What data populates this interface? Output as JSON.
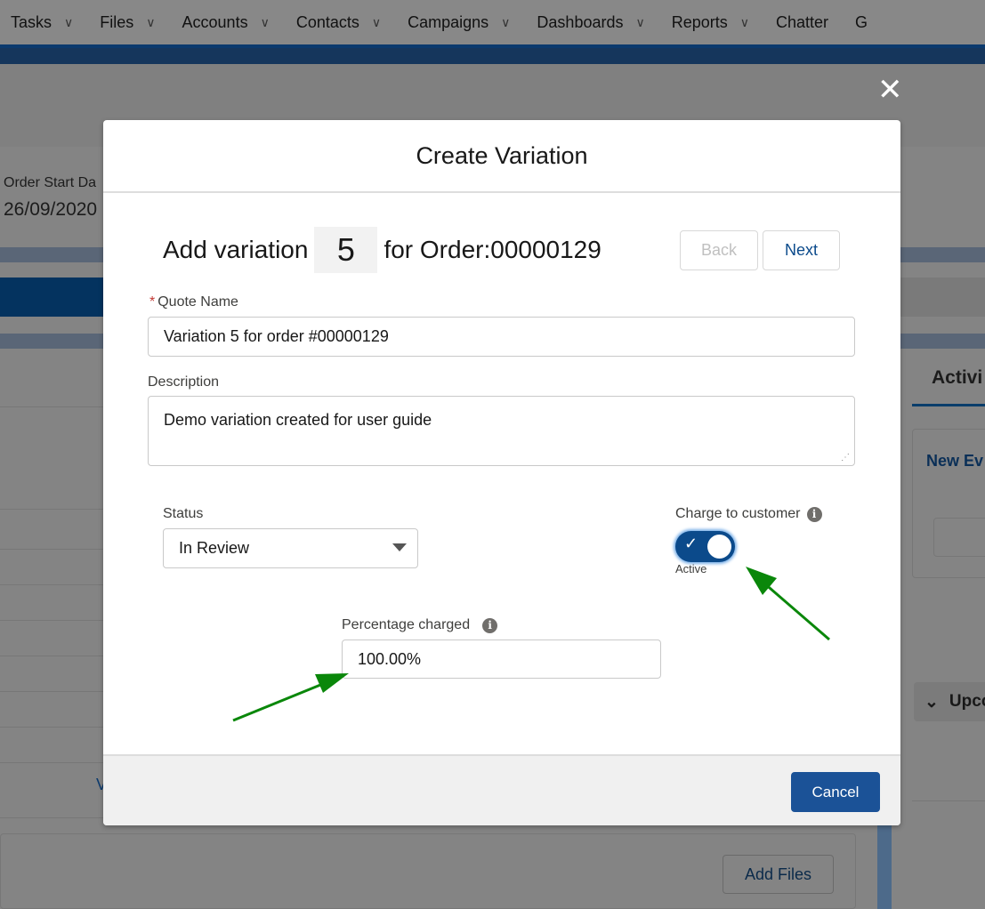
{
  "nav": {
    "items": [
      {
        "label": "Tasks",
        "dropdown": true
      },
      {
        "label": "Files",
        "dropdown": true
      },
      {
        "label": "Accounts",
        "dropdown": true
      },
      {
        "label": "Contacts",
        "dropdown": true
      },
      {
        "label": "Campaigns",
        "dropdown": true
      },
      {
        "label": "Dashboards",
        "dropdown": true
      },
      {
        "label": "Reports",
        "dropdown": true
      },
      {
        "label": "Chatter",
        "dropdown": false
      },
      {
        "label": "G",
        "dropdown": false
      }
    ]
  },
  "background": {
    "order_start_label": "Order Start Da",
    "order_start_value": "26/09/2020",
    "activity_tab": "Activi",
    "new_event": "New Ev",
    "upcoming": "Upco",
    "add_files": "Add Files",
    "partial_link": "V"
  },
  "modal": {
    "title": "Create Variation",
    "heading_prefix": "Add variation",
    "variation_number": "5",
    "heading_suffix": "for Order:00000129",
    "back_label": "Back",
    "next_label": "Next",
    "quote_name_label": "Quote Name",
    "required_marker": "*",
    "quote_name_value": "Variation 5 for order #00000129",
    "description_label": "Description",
    "description_value": "Demo variation created for user guide",
    "status_label": "Status",
    "status_value": "In Review",
    "charge_label": "Charge to customer",
    "charge_toggle_on": true,
    "charge_state_text": "Active",
    "percentage_label": "Percentage charged",
    "percentage_value": "100.00%",
    "cancel_label": "Cancel"
  },
  "colors": {
    "brand": "#0b4a8b",
    "button": "#1b5297",
    "annotation_arrow": "#0a870a"
  }
}
